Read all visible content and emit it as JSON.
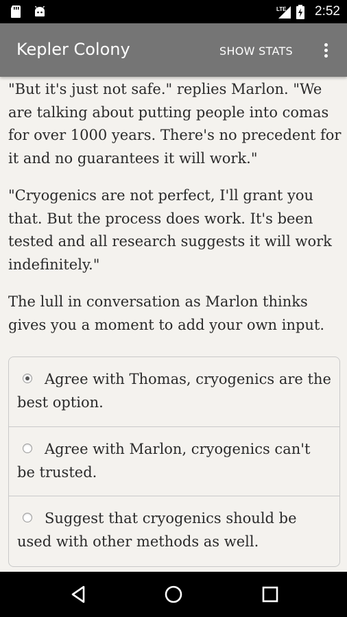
{
  "status_bar": {
    "time": "2:52",
    "network_label": "LTE",
    "icons": [
      "sd-card-icon",
      "android-icon",
      "signal-lte-icon",
      "battery-charging-icon"
    ]
  },
  "app_bar": {
    "title": "Kepler Colony",
    "show_stats_label": "SHOW STATS",
    "overflow_icon": "more-vert-icon"
  },
  "story": {
    "paragraphs": [
      "\"But it's just not safe.\" replies Marlon. \"We are talking about putting people into comas for over 1000 years. There's no precedent for it and no guarantees it will work.\"",
      "\"Cryogenics are not perfect, I'll grant you that. But the process does work. It's been tested and all research suggests it will work indefinitely.\"",
      "The lull in conversation as Marlon thinks gives you a moment to add your own input."
    ]
  },
  "choices": [
    {
      "label": "Agree with Thomas, cryogenics are the best option.",
      "selected": true
    },
    {
      "label": "Agree with Marlon, cryogenics can't be trusted.",
      "selected": false
    },
    {
      "label": "Suggest that cryogenics should be used with other methods as well.",
      "selected": false
    }
  ],
  "nav_bar": {
    "icons": [
      "back-icon",
      "home-icon",
      "recents-icon"
    ]
  },
  "colors": {
    "app_bar": "#757575",
    "background": "#f4f2ee",
    "status_bar": "#000000"
  }
}
